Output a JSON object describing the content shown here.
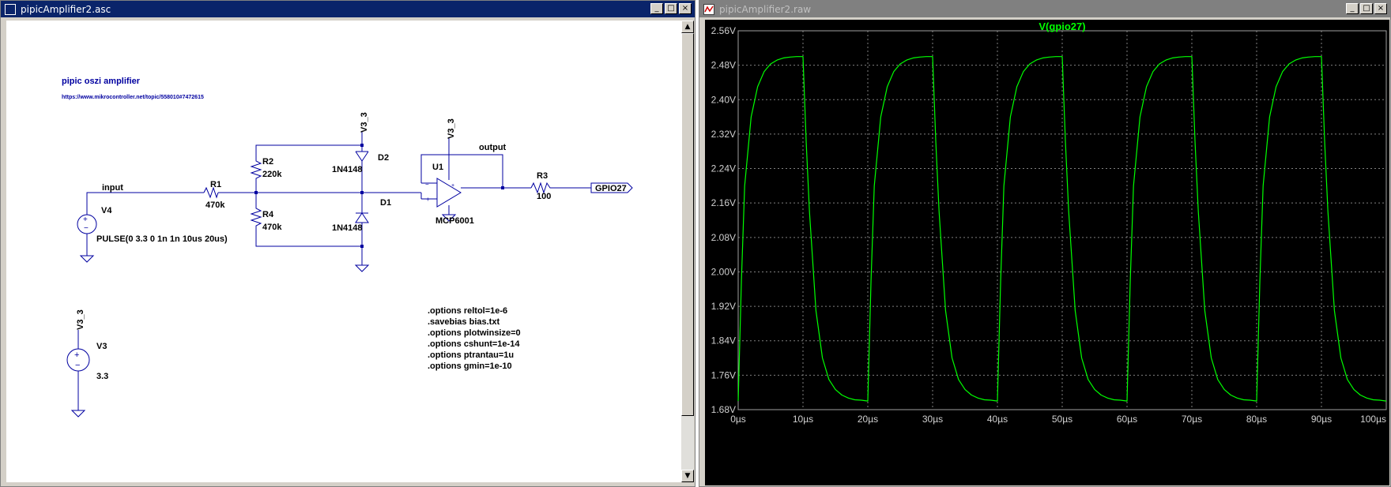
{
  "schematic_window": {
    "title": "pipicAmplifier2.asc",
    "buttons": {
      "minimize": "_",
      "maximize": "□",
      "close": "×"
    },
    "scroll_up": "▲",
    "scroll_down": "▼"
  },
  "waveform_window": {
    "title": "pipicAmplifier2.raw",
    "buttons": {
      "minimize": "_",
      "maximize": "□",
      "close": "×"
    }
  },
  "schematic": {
    "title": "pipic oszi amplifier",
    "url": "https://www.mikrocontroller.net/topic/558010#7472615",
    "net_labels": {
      "input": "input",
      "output": "output",
      "v3_3_d2": "V3_3",
      "v3_3_u1": "V3_3",
      "v3_3_v3": "V3_3",
      "gpio27": "GPIO27"
    },
    "components": {
      "r1": {
        "ref": "R1",
        "value": "470k"
      },
      "r2": {
        "ref": "R2",
        "value": "220k"
      },
      "r3": {
        "ref": "R3",
        "value": "100"
      },
      "r4": {
        "ref": "R4",
        "value": "470k"
      },
      "d1": {
        "ref": "D1",
        "value": "1N4148"
      },
      "d2": {
        "ref": "D2",
        "value": "1N4148"
      },
      "u1": {
        "ref": "U1",
        "value": "MCP6001"
      },
      "v3": {
        "ref": "V3",
        "value": "3.3"
      },
      "v4": {
        "ref": "V4",
        "value": "PULSE(0 3.3 0 1n 1n 10us 20us)"
      }
    },
    "directives": [
      ".options reltol=1e-6",
      ".savebias bias.txt",
      ".options plotwinsize=0",
      ".options cshunt=1e-14",
      ".options ptrantau=1u",
      ".options gmin=1e-10"
    ],
    "colors": {
      "wire": "#0000a0",
      "component": "#0000a0",
      "junction": "#0000a0"
    }
  },
  "chart_data": {
    "type": "line",
    "title": "V(gpio27)",
    "xlabel": "",
    "ylabel": "",
    "x_ticks": [
      "0µs",
      "10µs",
      "20µs",
      "30µs",
      "40µs",
      "50µs",
      "60µs",
      "70µs",
      "80µs",
      "90µs",
      "100µs"
    ],
    "y_ticks": [
      "1.68V",
      "1.76V",
      "1.84V",
      "1.92V",
      "2.00V",
      "2.08V",
      "2.16V",
      "2.24V",
      "2.32V",
      "2.40V",
      "2.48V",
      "2.56V"
    ],
    "xlim": [
      0,
      100
    ],
    "ylim": [
      1.68,
      2.56
    ],
    "x_unit": "µs",
    "y_unit": "V",
    "grid": true,
    "series": [
      {
        "name": "V(gpio27)",
        "color": "#00ff00",
        "x": [
          0,
          0.5,
          1,
          2,
          3,
          4,
          5,
          6,
          7,
          8,
          9,
          10,
          10.5,
          11,
          12,
          13,
          14,
          15,
          16,
          17,
          18,
          19,
          20,
          20.5,
          21,
          22,
          23,
          24,
          25,
          26,
          27,
          28,
          29,
          30,
          30.5,
          31,
          32,
          33,
          34,
          35,
          36,
          37,
          38,
          39,
          40,
          40.5,
          41,
          42,
          43,
          44,
          45,
          46,
          47,
          48,
          49,
          50,
          50.5,
          51,
          52,
          53,
          54,
          55,
          56,
          57,
          58,
          59,
          60,
          60.5,
          61,
          62,
          63,
          64,
          65,
          66,
          67,
          68,
          69,
          70,
          70.5,
          71,
          72,
          73,
          74,
          75,
          76,
          77,
          78,
          79,
          80,
          80.5,
          81,
          82,
          83,
          84,
          85,
          86,
          87,
          88,
          89,
          90,
          90.5,
          91,
          92,
          93,
          94,
          95,
          96,
          97,
          98,
          99,
          100
        ],
        "y": [
          1.7,
          1.98,
          2.2,
          2.36,
          2.43,
          2.465,
          2.483,
          2.492,
          2.497,
          2.499,
          2.5,
          2.5,
          2.3,
          2.14,
          1.91,
          1.8,
          1.75,
          1.727,
          1.714,
          1.707,
          1.703,
          1.702,
          1.7,
          1.98,
          2.2,
          2.36,
          2.43,
          2.465,
          2.483,
          2.492,
          2.497,
          2.499,
          2.5,
          2.5,
          2.3,
          2.14,
          1.91,
          1.8,
          1.75,
          1.727,
          1.714,
          1.707,
          1.703,
          1.702,
          1.7,
          1.98,
          2.2,
          2.36,
          2.43,
          2.465,
          2.483,
          2.492,
          2.497,
          2.499,
          2.5,
          2.5,
          2.3,
          2.14,
          1.91,
          1.8,
          1.75,
          1.727,
          1.714,
          1.707,
          1.703,
          1.702,
          1.7,
          1.98,
          2.2,
          2.36,
          2.43,
          2.465,
          2.483,
          2.492,
          2.497,
          2.499,
          2.5,
          2.5,
          2.3,
          2.14,
          1.91,
          1.8,
          1.75,
          1.727,
          1.714,
          1.707,
          1.703,
          1.702,
          1.7,
          1.98,
          2.2,
          2.36,
          2.43,
          2.465,
          2.483,
          2.492,
          2.497,
          2.499,
          2.5,
          2.5,
          2.3,
          2.14,
          1.91,
          1.8,
          1.75,
          1.727,
          1.714,
          1.707,
          1.703,
          1.702,
          1.7
        ]
      }
    ],
    "colors": {
      "background": "#000000",
      "grid": "#808080",
      "axis_text": "#d0d0d0",
      "trace": "#00ff00"
    }
  }
}
